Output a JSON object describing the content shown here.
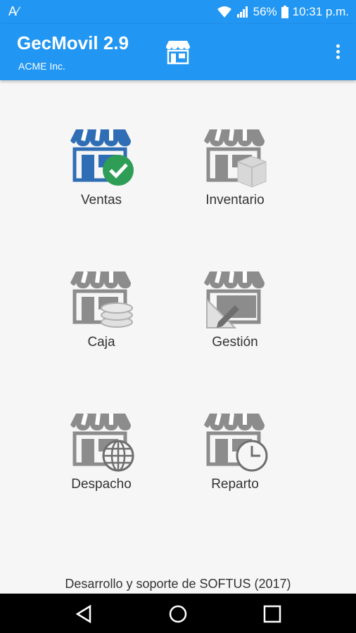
{
  "status_bar": {
    "carrier": "A∕",
    "battery": "56%",
    "time": "10:31 p.m."
  },
  "app_bar": {
    "title": "GecMovil 2.9",
    "subtitle": "ACME Inc.",
    "menu_icon": "more-vert-icon"
  },
  "tiles": [
    {
      "label": "Ventas"
    },
    {
      "label": "Inventario"
    },
    {
      "label": "Caja"
    },
    {
      "label": "Gestión"
    },
    {
      "label": "Despacho"
    },
    {
      "label": "Reparto"
    }
  ],
  "footer": "Desarrollo y soporte de SOFTUS (2017)",
  "colors": {
    "primary": "#2196f3",
    "store_gray": "#8c8c8c",
    "store_blue": "#2f6db5",
    "check_green": "#2e9e57"
  }
}
